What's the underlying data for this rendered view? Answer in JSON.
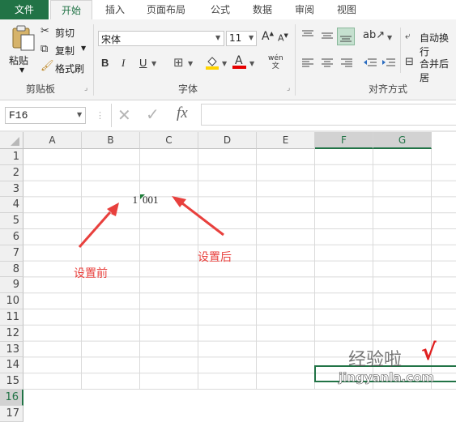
{
  "ribbon": {
    "tabs": [
      "文件",
      "开始",
      "插入",
      "页面布局",
      "公式",
      "数据",
      "审阅",
      "视图"
    ],
    "clipboard": {
      "paste": "粘贴",
      "cut": "剪切",
      "copy": "复制",
      "format_painter": "格式刷",
      "label": "剪贴板"
    },
    "font": {
      "name": "宋体",
      "size": "11",
      "label": "字体",
      "bold": "B",
      "italic": "I",
      "underline": "U",
      "wen": "wén"
    },
    "alignment": {
      "wrap": "自动换行",
      "merge": "合并后居",
      "label": "对齐方式"
    }
  },
  "formula_bar": {
    "name_box": "F16",
    "fx": "fx",
    "formula": ""
  },
  "sheet": {
    "columns": [
      "A",
      "B",
      "C",
      "D",
      "E",
      "F",
      "G"
    ],
    "selected_columns": [
      "F",
      "G"
    ],
    "rows": [
      "1",
      "2",
      "3",
      "4",
      "5",
      "6",
      "7",
      "8",
      "9",
      "10",
      "11",
      "12",
      "13",
      "14",
      "15",
      "16",
      "17"
    ],
    "selected_row": "16",
    "cells": {
      "B4": "1",
      "C4": "001"
    }
  },
  "annotations": {
    "before": "设置前",
    "after": "设置后"
  },
  "watermark": {
    "text1": "经验啦",
    "text2": "jingyanla.com",
    "check": "√"
  },
  "colors": {
    "accent": "#217346",
    "annotation": "#e8403d"
  }
}
